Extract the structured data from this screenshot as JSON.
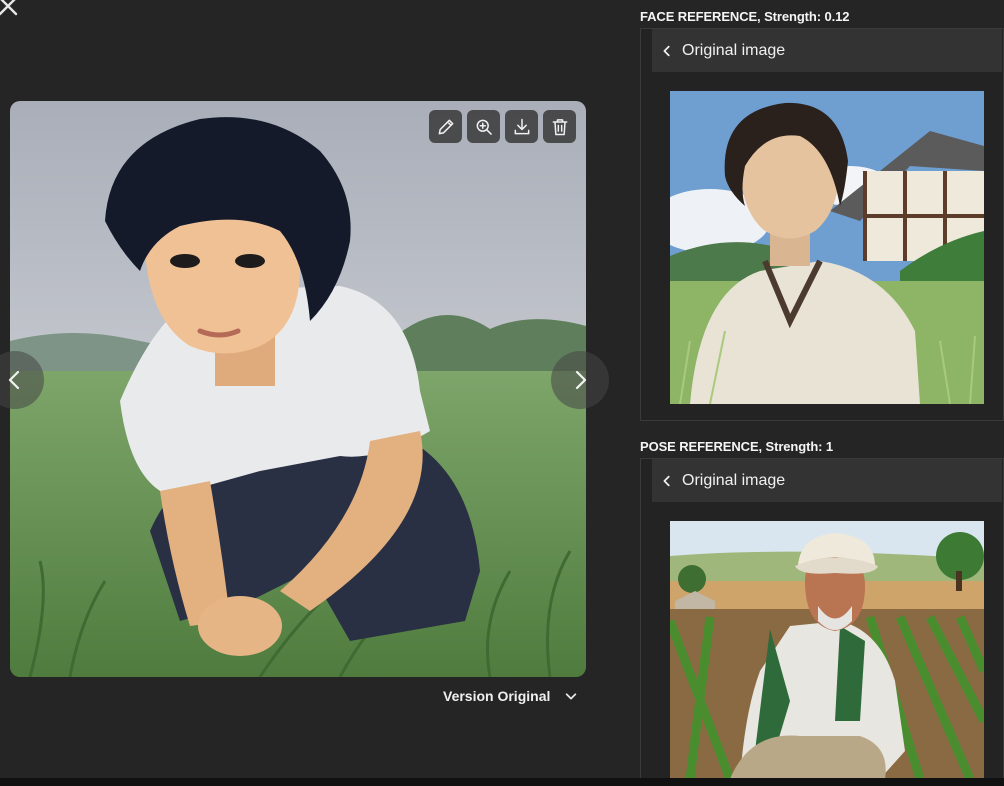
{
  "close_icon": "close-icon",
  "main_image": {
    "alt": "Anime-style portrait of a young man crouching in a green grass field",
    "toolbar": [
      {
        "name": "edit-button",
        "icon": "pencil-icon"
      },
      {
        "name": "zoom-button",
        "icon": "zoom-in-icon"
      },
      {
        "name": "download-button",
        "icon": "download-icon"
      },
      {
        "name": "delete-button",
        "icon": "trash-icon"
      }
    ],
    "nav": {
      "prev_icon": "chevron-left-icon",
      "next_icon": "chevron-right-icon"
    }
  },
  "version": {
    "label": "Version Original",
    "icon": "chevron-down-icon"
  },
  "face_reference": {
    "title": "FACE REFERENCE, Strength: 0.12",
    "header_label": "Original image",
    "header_icon": "chevron-left-icon",
    "image_alt": "Young man in white tunic standing in a field near a traditional house"
  },
  "pose_reference": {
    "title": "POSE REFERENCE, Strength: 1",
    "header_label": "Original image",
    "header_icon": "chevron-left-icon",
    "image_alt": "Elderly farmer in turban crouching in a crop field"
  },
  "colors": {
    "background": "#252525",
    "panel_header": "#333333",
    "text": "#f0f0f0"
  }
}
